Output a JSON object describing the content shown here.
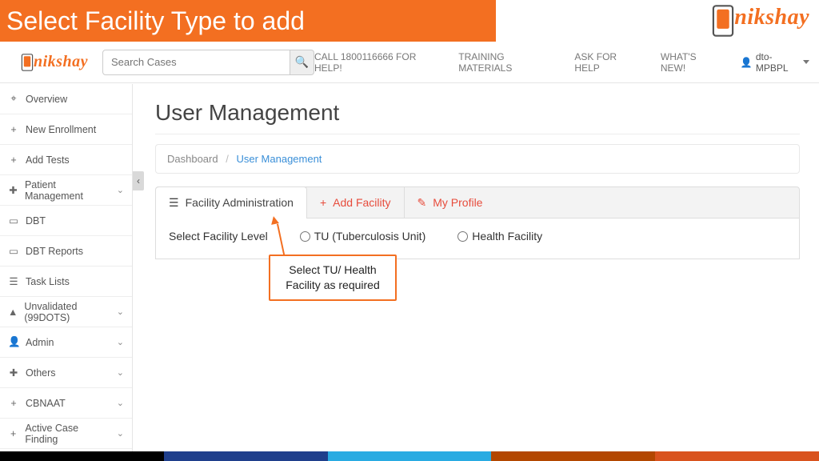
{
  "banner": {
    "title": "Select Facility Type to add"
  },
  "brand": {
    "name": "nikshay"
  },
  "nav": {
    "search_placeholder": "Search Cases",
    "links": {
      "help_phone": "CALL 1800116666 FOR HELP!",
      "training": "TRAINING MATERIALS",
      "ask_help": "ASK FOR HELP",
      "whats_new": "WHAT'S NEW!"
    },
    "user": "dto-MPBPL"
  },
  "sidebar": {
    "items": [
      {
        "icon": "⌖",
        "label": "Overview",
        "expandable": false
      },
      {
        "icon": "+",
        "label": "New Enrollment",
        "expandable": false
      },
      {
        "icon": "+",
        "label": "Add Tests",
        "expandable": false
      },
      {
        "icon": "✚",
        "label": "Patient Management",
        "expandable": true
      },
      {
        "icon": "▭",
        "label": "DBT",
        "expandable": false
      },
      {
        "icon": "▭",
        "label": "DBT Reports",
        "expandable": false
      },
      {
        "icon": "☰",
        "label": "Task Lists",
        "expandable": false
      },
      {
        "icon": "▲",
        "label": "Unvalidated (99DOTS)",
        "expandable": true
      },
      {
        "icon": "👤",
        "label": "Admin",
        "expandable": true
      },
      {
        "icon": "✚",
        "label": "Others",
        "expandable": true
      },
      {
        "icon": "+",
        "label": "CBNAAT",
        "expandable": true
      },
      {
        "icon": "+",
        "label": "Active Case Finding",
        "expandable": true
      }
    ]
  },
  "page": {
    "title": "User Management",
    "breadcrumb": {
      "root": "Dashboard",
      "current": "User Management"
    },
    "tabs": {
      "facility_admin": "Facility Administration",
      "add_facility": "Add Facility",
      "my_profile": "My Profile"
    },
    "select_label": "Select Facility Level",
    "options": {
      "tu": "TU (Tuberculosis Unit)",
      "hf": "Health Facility"
    }
  },
  "callout": {
    "text1": "Select TU/ Health",
    "text2": "Facility as required"
  },
  "footer_colors": [
    "#000000",
    "#1f3f8c",
    "#29abe2",
    "#b34700",
    "#d9531e"
  ]
}
